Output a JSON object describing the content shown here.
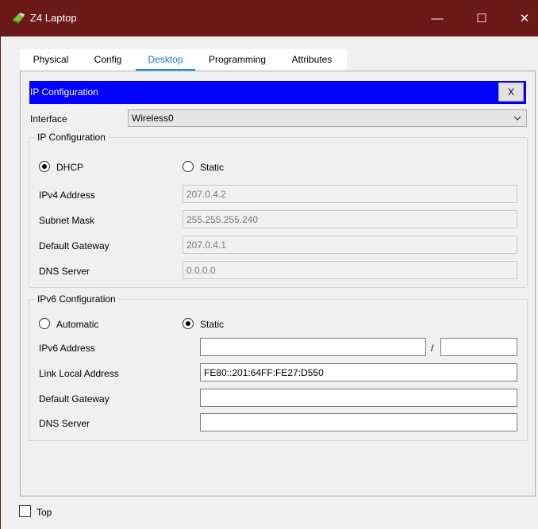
{
  "window": {
    "title": "Z4 Laptop",
    "minimize_glyph": "—",
    "maximize_glyph": "☐",
    "close_glyph": "✕",
    "titlebar_color": "#6b1a17"
  },
  "tabs": [
    {
      "label": "Physical"
    },
    {
      "label": "Config"
    },
    {
      "label": "Desktop",
      "active": true
    },
    {
      "label": "Programming"
    },
    {
      "label": "Attributes"
    }
  ],
  "ip_config": {
    "header": "IP Configuration",
    "close_label": "X",
    "header_color": "#0000ff",
    "interface_label": "Interface",
    "interface_value": "Wireless0",
    "ipv4": {
      "legend": "IP Configuration",
      "dhcp_label": "DHCP",
      "static_label": "Static",
      "selected": "DHCP",
      "ipv4_address_label": "IPv4 Address",
      "ipv4_address": "207.0.4.2",
      "subnet_mask_label": "Subnet Mask",
      "subnet_mask": "255.255.255.240",
      "default_gateway_label": "Default Gateway",
      "default_gateway": "207.0.4.1",
      "dns_server_label": "DNS Server",
      "dns_server": "0.0.0.0"
    },
    "ipv6": {
      "legend": "IPv6 Configuration",
      "automatic_label": "Automatic",
      "static_label": "Static",
      "selected": "Static",
      "ipv6_address_label": "IPv6 Address",
      "ipv6_address": "",
      "prefix_separator": "/",
      "prefix_length": "",
      "link_local_label": "Link Local Address",
      "link_local": "FE80::201:64FF:FE27:D550",
      "default_gateway_label": "Default Gateway",
      "default_gateway": "",
      "dns_server_label": "DNS Server",
      "dns_server": ""
    }
  },
  "footer": {
    "top_label": "Top",
    "top_checked": false
  }
}
